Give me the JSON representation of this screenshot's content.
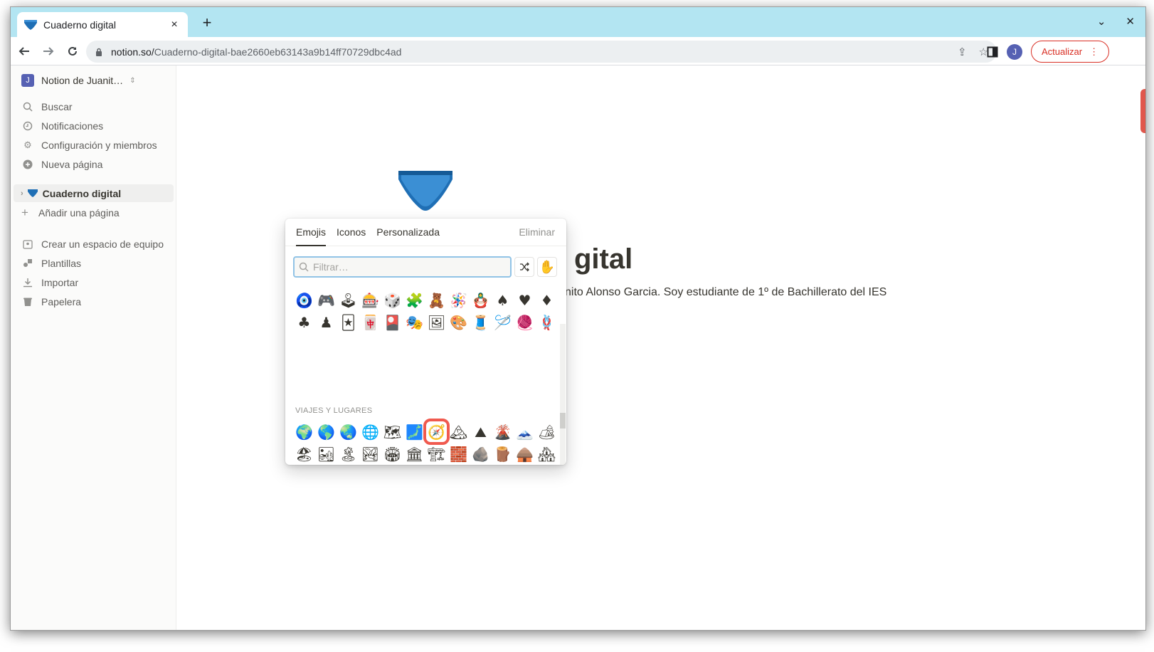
{
  "browser": {
    "tab_title": "Cuaderno digital",
    "tab_close": "×",
    "new_tab": "+",
    "url_host": "notion.so/",
    "url_path": "Cuaderno-digital-bae2660eb63143a9b14ff70729dbc4ad",
    "update_label": "Actualizar",
    "profile_initial": "J",
    "more_icon": "⋮"
  },
  "sidebar": {
    "workspace_name": "Notion de Juanit…",
    "workspace_initial": "J",
    "items": [
      {
        "label": "Buscar",
        "icon": "search-icon"
      },
      {
        "label": "Notificaciones",
        "icon": "clock-icon"
      },
      {
        "label": "Configuración y miembros",
        "icon": "gear-icon"
      },
      {
        "label": "Nueva página",
        "icon": "plus-circle-icon"
      }
    ],
    "page": "Cuaderno digital",
    "add_page": "Añadir una página",
    "bottom_items": [
      {
        "label": "Crear un espacio de equipo",
        "icon": "team-icon"
      },
      {
        "label": "Plantillas",
        "icon": "templates-icon"
      },
      {
        "label": "Importar",
        "icon": "import-icon"
      },
      {
        "label": "Papelera",
        "icon": "trash-icon"
      }
    ]
  },
  "page": {
    "title_visible": "gital",
    "description_visible": "nito Alonso Garcia. Soy estudiante de 1º de Bachillerato del IES"
  },
  "picker": {
    "tabs": [
      "Emojis",
      "Iconos",
      "Personalizada"
    ],
    "active_tab": "Emojis",
    "remove_label": "Eliminar",
    "filter_placeholder": "Filtrar…",
    "skin_tone": "✋",
    "section_label": "VIAJES Y LUGARES",
    "activity_rows": [
      [
        "🧿",
        "🎮",
        "🕹",
        "🎰",
        "🎲",
        "🧩",
        "🧸",
        "🪅",
        "🪆",
        "♠",
        "♥",
        "♦"
      ],
      [
        "♣",
        "♟",
        "🃏",
        "🀄",
        "🎴",
        "🎭",
        "🖼",
        "🎨",
        "🧵",
        "🪡",
        "🧶",
        "🪢"
      ]
    ],
    "travel_rows": [
      [
        "🌍",
        "🌎",
        "🌏",
        "🌐",
        "🗺",
        "🗾",
        "🧭",
        "🏔",
        "⛰",
        "🌋",
        "🗻",
        "🏕"
      ],
      [
        "🏖",
        "🏜",
        "🏝",
        "🏞",
        "🏟",
        "🏛",
        "🏗",
        "🧱",
        "🪨",
        "🪵",
        "🛖",
        "🏘"
      ],
      [
        "🏚",
        "🏠",
        "🏡",
        "🏢",
        "🏣",
        "🏤",
        "🏥",
        "🏦",
        "🏨",
        "🏩",
        "🏪",
        "🏫"
      ],
      [
        "🏬",
        "🏭",
        "🏯",
        "🏰",
        "💒",
        "🗼",
        "🗽",
        "⛪",
        "🕌",
        "🛕",
        "🕍",
        "⛩"
      ],
      [
        "🕋",
        "⛲",
        "⛺",
        "🌁",
        "🌃",
        "🏙",
        "🌄",
        "🌅",
        "🌆",
        "🌇",
        "🌉",
        "♨"
      ]
    ],
    "highlighted": "🧭"
  }
}
